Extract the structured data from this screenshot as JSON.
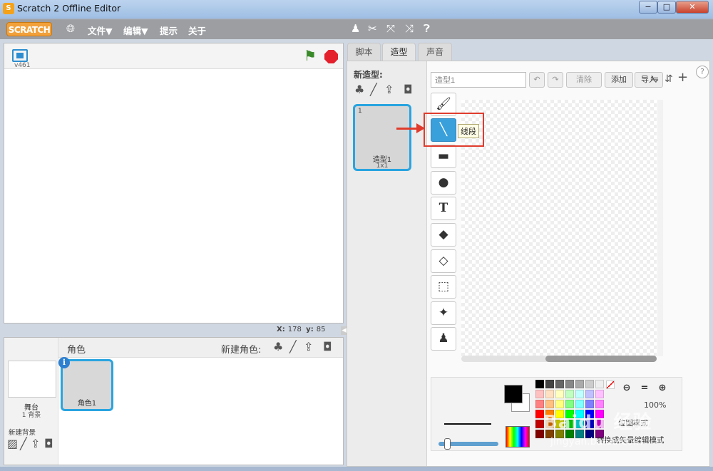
{
  "window": {
    "title": "Scratch 2 Offline Editor",
    "min": "−",
    "max": "□",
    "close": "✕",
    "app_icon": "cat-icon"
  },
  "menubar": {
    "logo": "SCRATCH",
    "items": [
      "文件▼",
      "编辑▼",
      "提示",
      "关于"
    ],
    "icons": [
      "globe-icon",
      "duplicate-icon",
      "delete-icon",
      "grow-icon",
      "shrink-icon",
      "help-icon"
    ]
  },
  "stage": {
    "version": "v461",
    "x_label": "X:",
    "x_value": "178",
    "y_label": "y:",
    "y_value": "85"
  },
  "sprites_pane": {
    "title": "角色",
    "new_sprite_label": "新建角色:",
    "stage_label": "舞台",
    "stage_bg_count": "1 背景",
    "new_backdrop_label": "新建背景",
    "sprite_name": "角色1"
  },
  "tabs": [
    "脚本",
    "造型",
    "声音"
  ],
  "costumes": {
    "new_costume_label": "新造型:",
    "number": "1",
    "name": "造型1",
    "size": "1x1"
  },
  "paint_editor": {
    "costume_name": "造型1",
    "clear_label": "清除",
    "add_label": "添加",
    "import_label": "导入",
    "zoom_level": "100%",
    "mode_label": "位图模式",
    "convert_label": "转换成矢量编辑模式",
    "tooltip": "线段",
    "tools": [
      "brush-icon",
      "line-icon",
      "rectangle-icon",
      "ellipse-icon",
      "text-icon",
      "fill-icon",
      "eraser-icon",
      "select-icon",
      "magic-wand-icon",
      "stamp-icon"
    ],
    "active_tool": "line-icon"
  },
  "palette": [
    "#000000",
    "#444444",
    "#666666",
    "#888888",
    "#aaaaaa",
    "#cccccc",
    "#eeeeee",
    "#ffc0c0",
    "#ffe0c0",
    "#ffffc0",
    "#c0ffc0",
    "#c0ffff",
    "#c0c0ff",
    "#ffc0ff",
    "#ff8080",
    "#ffc080",
    "#ffff80",
    "#80ff80",
    "#80ffff",
    "#8080ff",
    "#ff80ff",
    "#ff0000",
    "#ff8000",
    "#ffff00",
    "#00ff00",
    "#00ffff",
    "#0000ff",
    "#ff00ff",
    "#c00000",
    "#c06000",
    "#c0c000",
    "#00c000",
    "#00c0c0",
    "#0000c0",
    "#c000c0",
    "#800000",
    "#804000",
    "#808000",
    "#008000",
    "#008080",
    "#000080",
    "#800080"
  ],
  "watermark": {
    "main": "Baidu 经验",
    "sub": "jingyan.baidu.com"
  },
  "accent": "#29a4e0",
  "annotation_color": "#e03c2d"
}
